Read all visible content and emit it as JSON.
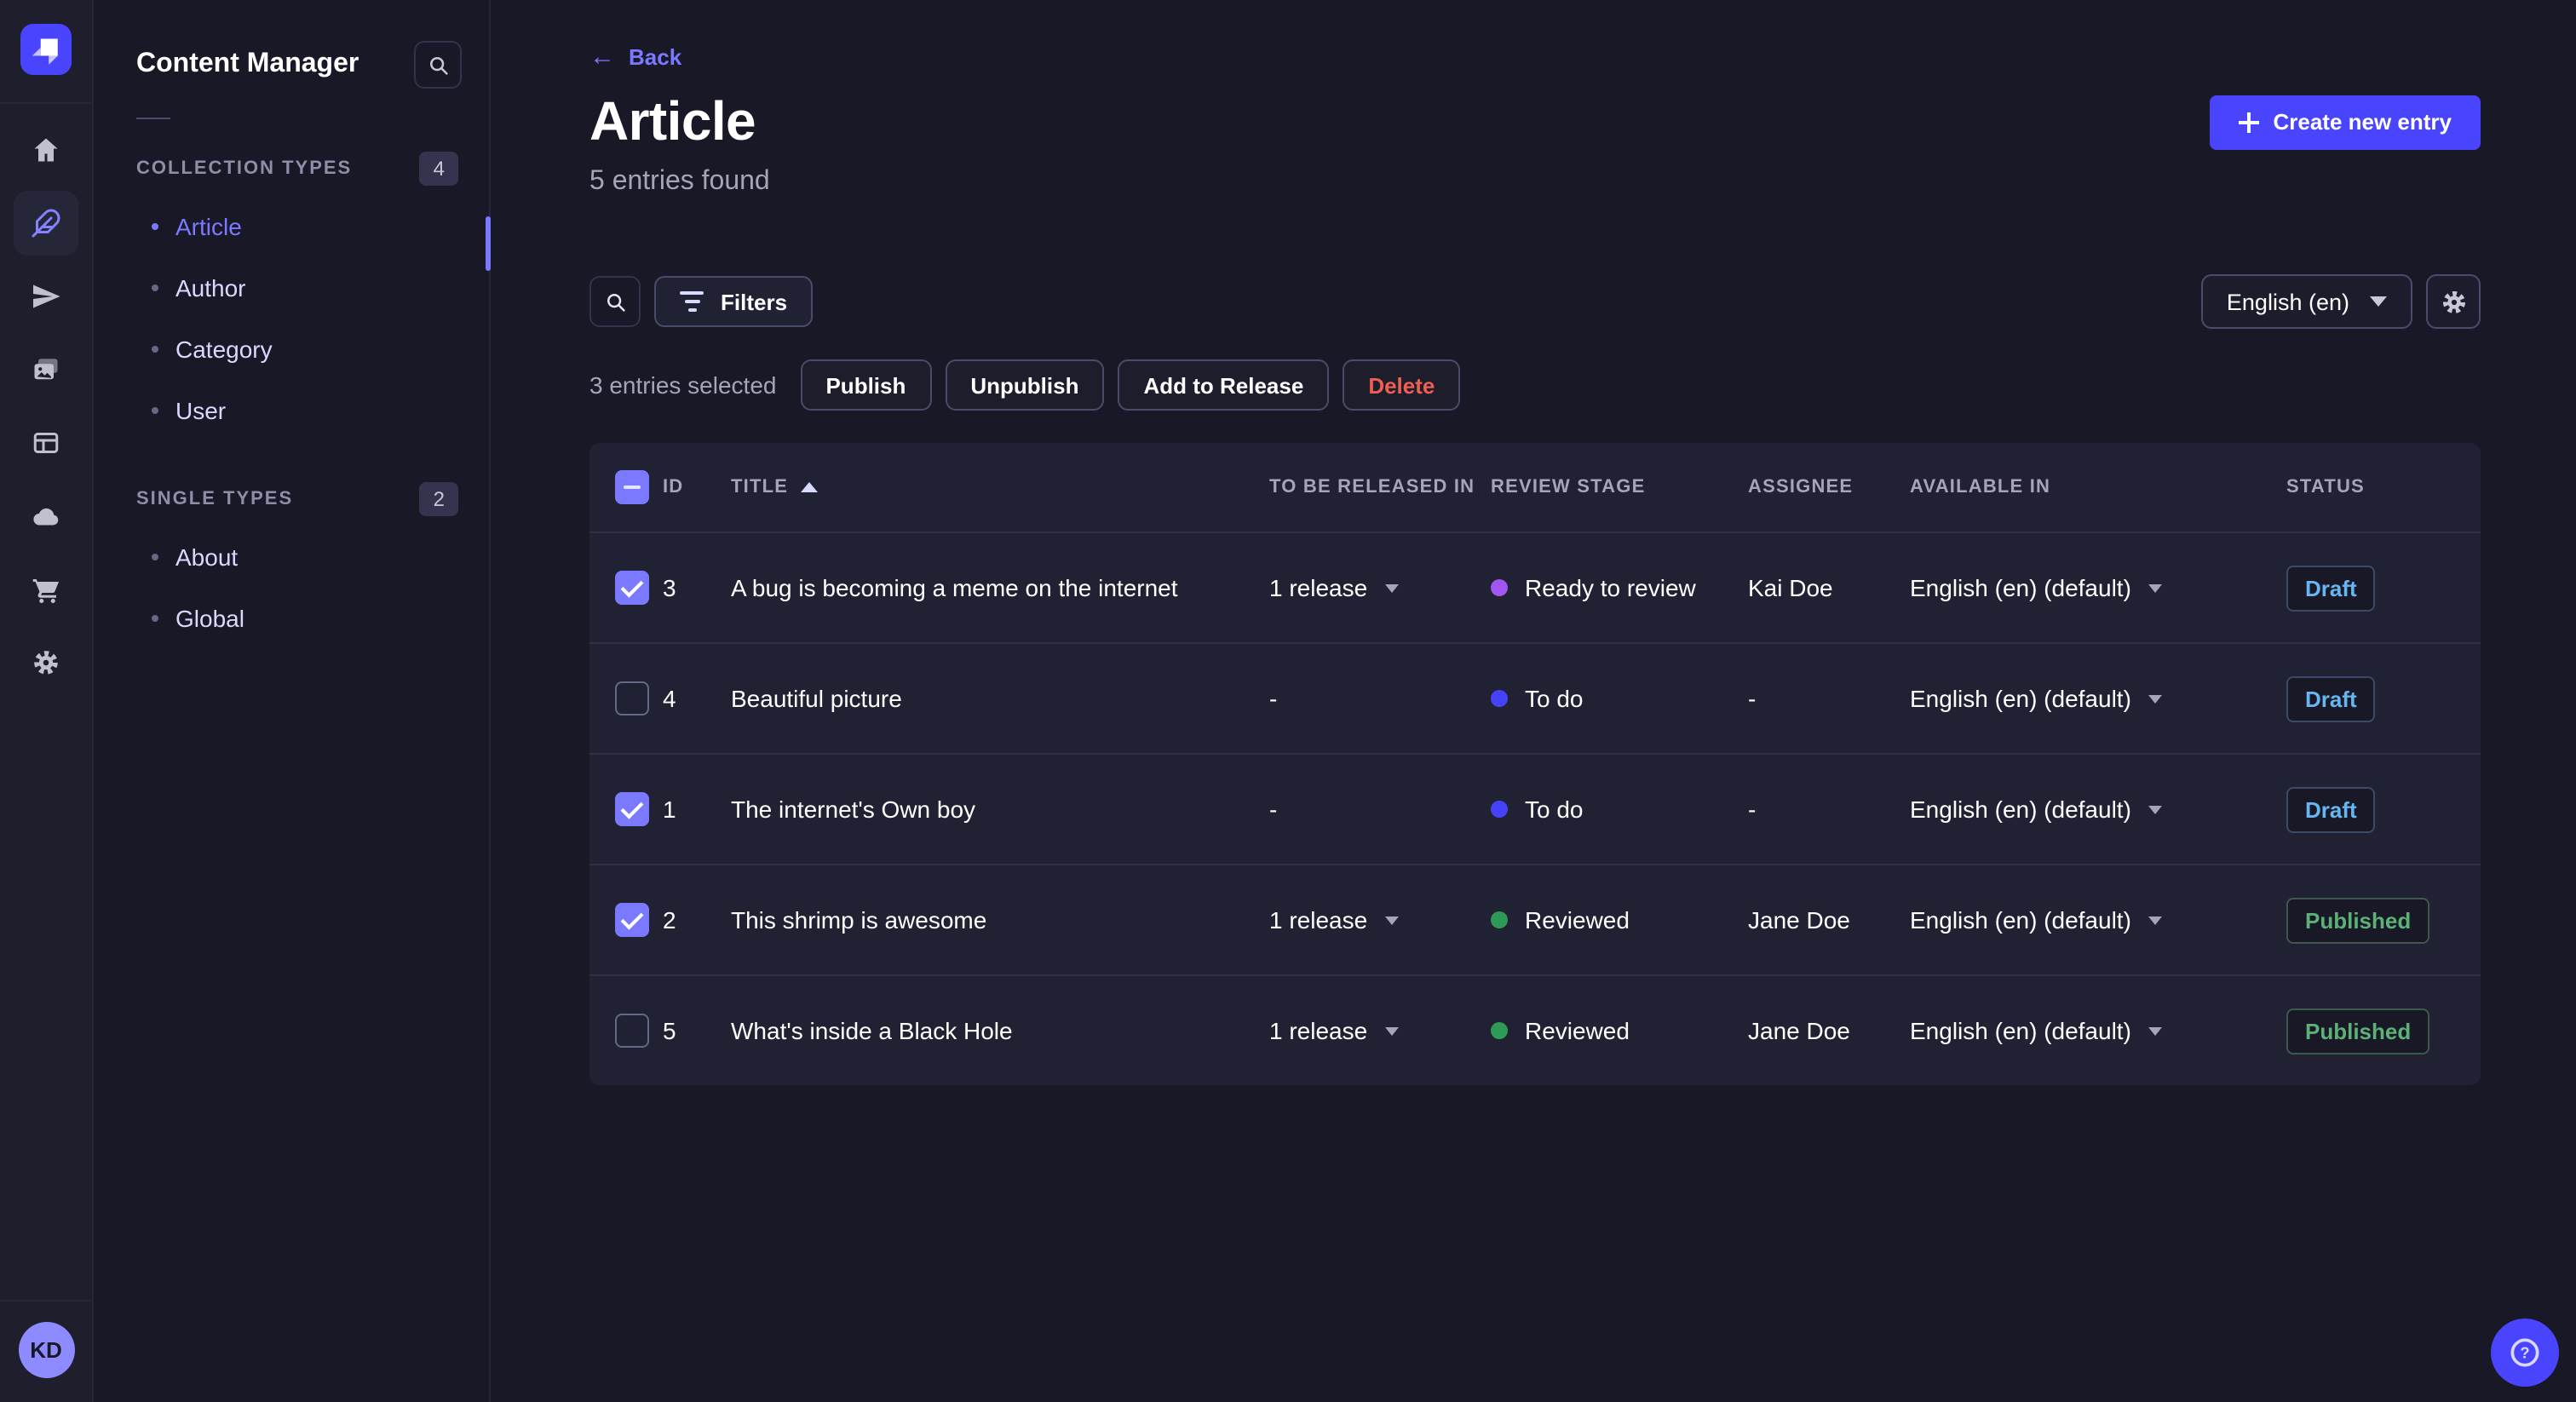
{
  "nav_rail": {
    "logo": "strapi-logo",
    "items": [
      {
        "icon": "home"
      },
      {
        "icon": "feather-content-manager",
        "active": true
      },
      {
        "icon": "paper-plane-releases"
      },
      {
        "icon": "media-gallery"
      },
      {
        "icon": "layout-builder"
      },
      {
        "icon": "cloud-deploy"
      },
      {
        "icon": "shopping-cart-marketplace"
      },
      {
        "icon": "gear-settings"
      }
    ],
    "avatar_initials": "KD"
  },
  "subnav": {
    "title": "Content Manager",
    "sections": [
      {
        "label": "COLLECTION TYPES",
        "count": "4",
        "items": [
          {
            "label": "Article",
            "active": true
          },
          {
            "label": "Author"
          },
          {
            "label": "Category"
          },
          {
            "label": "User"
          }
        ]
      },
      {
        "label": "SINGLE TYPES",
        "count": "2",
        "items": [
          {
            "label": "About"
          },
          {
            "label": "Global"
          }
        ]
      }
    ]
  },
  "header": {
    "back": "Back",
    "title": "Article",
    "subtitle": "5 entries found",
    "create_button": "Create new entry"
  },
  "toolbar": {
    "filters": "Filters",
    "locale": "English (en)"
  },
  "selection": {
    "text": "3 entries selected",
    "publish": "Publish",
    "unpublish": "Unpublish",
    "add_to_release": "Add to Release",
    "delete": "Delete"
  },
  "table": {
    "columns": [
      {
        "key": "id",
        "label": "ID"
      },
      {
        "key": "title",
        "label": "TITLE",
        "sorted": "asc"
      },
      {
        "key": "release",
        "label": "TO BE RELEASED IN"
      },
      {
        "key": "stage",
        "label": "REVIEW STAGE"
      },
      {
        "key": "assignee",
        "label": "ASSIGNEE"
      },
      {
        "key": "available",
        "label": "AVAILABLE IN"
      },
      {
        "key": "status",
        "label": "STATUS"
      }
    ],
    "rows": [
      {
        "checked": true,
        "id": "3",
        "title": "A bug is becoming a meme on the internet",
        "release": "1 release",
        "stage": "Ready to review",
        "assignee": "Kai Doe",
        "available": "English (en) (default)",
        "status": "Draft"
      },
      {
        "checked": false,
        "id": "4",
        "title": "Beautiful picture",
        "release": "-",
        "stage": "To do",
        "assignee": "-",
        "available": "English (en) (default)",
        "status": "Draft"
      },
      {
        "checked": true,
        "id": "1",
        "title": "The internet's Own boy",
        "release": "-",
        "stage": "To do",
        "assignee": "-",
        "available": "English (en) (default)",
        "status": "Draft"
      },
      {
        "checked": true,
        "id": "2",
        "title": "This shrimp is awesome",
        "release": "1 release",
        "stage": "Reviewed",
        "assignee": "Jane Doe",
        "available": "English (en) (default)",
        "status": "Published"
      },
      {
        "checked": false,
        "id": "5",
        "title": "What's inside a Black Hole",
        "release": "1 release",
        "stage": "Reviewed",
        "assignee": "Jane Doe",
        "available": "English (en) (default)",
        "status": "Published"
      }
    ]
  },
  "colors": {
    "accent": "#4945ff",
    "link": "#7b79ff",
    "draft_text": "#66b7f1",
    "published_text": "#5cb176",
    "danger": "#ee5e52",
    "stage_colors": {
      "Ready to review": "#a355f0",
      "To do": "#4641fa",
      "Reviewed": "#2e9a57"
    }
  }
}
